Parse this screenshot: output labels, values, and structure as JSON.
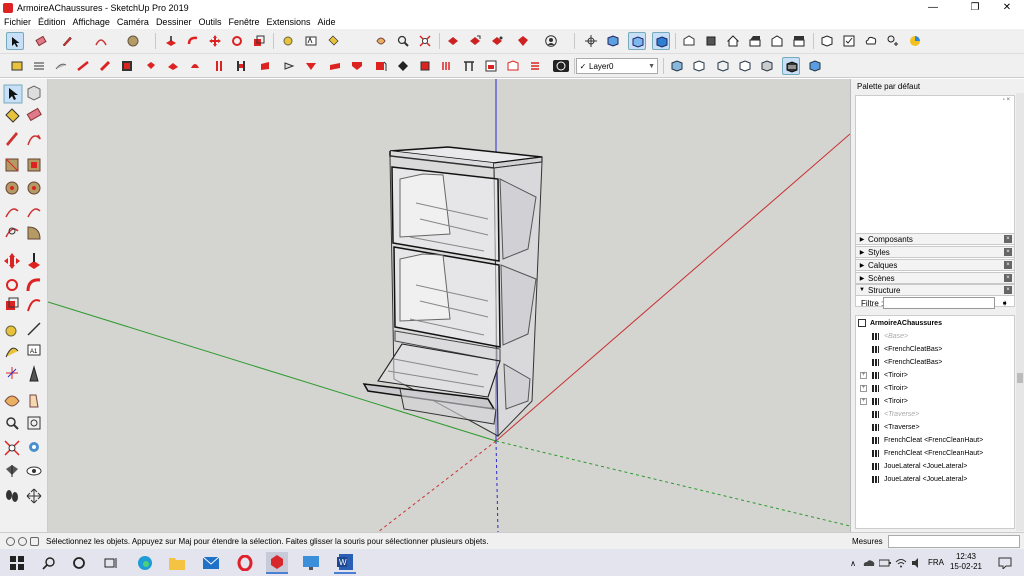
{
  "window": {
    "title": "ArmoireAChaussures - SketchUp Pro 2019",
    "minimize": "—",
    "maximize": "❐",
    "close": "✕"
  },
  "menu": [
    "Fichier",
    "Édition",
    "Affichage",
    "Caméra",
    "Dessiner",
    "Outils",
    "Fenêtre",
    "Extensions",
    "Aide"
  ],
  "layer": {
    "check": "✓",
    "value": "Layer0"
  },
  "tray": {
    "title": "Palette par défaut",
    "panels": [
      {
        "label": "Composants",
        "expanded": false
      },
      {
        "label": "Styles",
        "expanded": false
      },
      {
        "label": "Calques",
        "expanded": false
      },
      {
        "label": "Scènes",
        "expanded": false
      },
      {
        "label": "Structure",
        "expanded": true
      }
    ],
    "filter_label": "Filtre :",
    "outliner": {
      "root": "ArmoireAChaussures",
      "items": [
        {
          "label": "<Base>",
          "hidden": true,
          "expandable": false
        },
        {
          "label": "<FrenchCleatBas>",
          "hidden": false,
          "expandable": false
        },
        {
          "label": "<FrenchCleatBas>",
          "hidden": false,
          "expandable": false
        },
        {
          "label": "<Tiroir>",
          "hidden": false,
          "expandable": true
        },
        {
          "label": "<Tiroir>",
          "hidden": false,
          "expandable": true
        },
        {
          "label": "<Tiroir>",
          "hidden": false,
          "expandable": true
        },
        {
          "label": "<Traverse>",
          "hidden": true,
          "expandable": false
        },
        {
          "label": "<Traverse>",
          "hidden": false,
          "expandable": false
        },
        {
          "label": "FrenchCleat <FrencCleanHaut>",
          "hidden": false,
          "expandable": false
        },
        {
          "label": "FrenchCleat <FrencCleanHaut>",
          "hidden": false,
          "expandable": false
        },
        {
          "label": "JoueLateral <JoueLateral>",
          "hidden": false,
          "expandable": false
        },
        {
          "label": "JoueLateral <JoueLateral>",
          "hidden": false,
          "expandable": false
        }
      ]
    }
  },
  "status": {
    "text": "Sélectionnez les objets. Appuyez sur Maj pour étendre la sélection. Faites glisser la souris pour sélectionner plusieurs objets.",
    "measures_label": "Mesures"
  },
  "taskbar": {
    "lang": "FRA",
    "time": "12:43",
    "date": "15-02-21"
  },
  "colors": {
    "axis_red": "#c83232",
    "axis_green": "#2c9a2c",
    "axis_blue": "#2a2ad0",
    "viewport_bg": "#d4d4d1"
  }
}
